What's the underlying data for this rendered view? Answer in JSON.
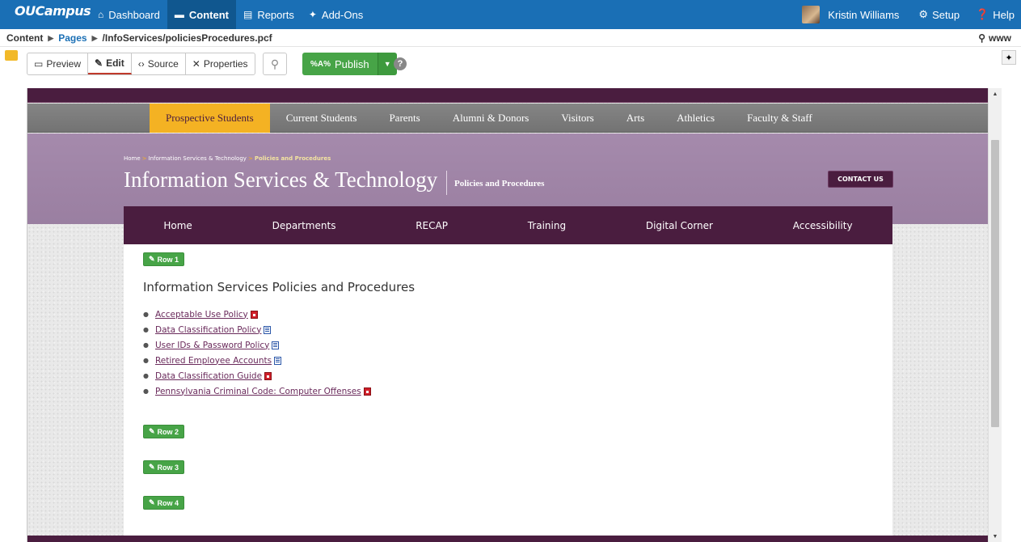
{
  "app": {
    "logo": "OUCampus",
    "nav": [
      {
        "label": "Dashboard",
        "icon": "home-icon",
        "active": false
      },
      {
        "label": "Content",
        "icon": "folder-icon",
        "active": true
      },
      {
        "label": "Reports",
        "icon": "report-icon",
        "active": false
      },
      {
        "label": "Add-Ons",
        "icon": "pin-icon",
        "active": false
      }
    ],
    "user": "Kristin Williams",
    "setup": "Setup",
    "help": "Help"
  },
  "breadcrumb": {
    "root": "Content",
    "pages": "Pages",
    "path": "/InfoServices/policiesProcedures.pcf",
    "server": "www"
  },
  "toolbar": {
    "preview": "Preview",
    "edit": "Edit",
    "source": "Source",
    "properties": "Properties",
    "publish": "Publish",
    "publish_icon_text": "%A%"
  },
  "site": {
    "main_nav": [
      "Prospective Students",
      "Current Students",
      "Parents",
      "Alumni & Donors",
      "Visitors",
      "Arts",
      "Athletics",
      "Faculty & Staff"
    ],
    "breadcrumb": [
      "Home",
      "Information Services & Technology",
      "Policies and Procedures"
    ],
    "department": "Information Services & Technology",
    "subtitle": "Policies and Procedures",
    "contact": "CONTACT US",
    "sub_nav": [
      "Home",
      "Departments",
      "RECAP",
      "Training",
      "Digital Corner",
      "Accessibility"
    ],
    "rows": [
      "Row 1",
      "Row 2",
      "Row 3",
      "Row 4"
    ],
    "heading": "Information Services Policies and Procedures",
    "links": [
      {
        "text": "Acceptable Use Policy",
        "type": "pdf"
      },
      {
        "text": "Data Classification Policy",
        "type": "word"
      },
      {
        "text": "User IDs & Password Policy",
        "type": "word"
      },
      {
        "text": "Retired Employee Accounts",
        "type": "word"
      },
      {
        "text": "Data Classification Guide",
        "type": "pdf"
      },
      {
        "text": "Pennsylvania Criminal Code: Computer Offenses",
        "type": "pdf"
      }
    ]
  },
  "colors": {
    "app_bar": "#1a6fb5",
    "publish_green": "#47a447",
    "site_purple": "#4a1d3f",
    "site_gold": "#f4b223"
  }
}
